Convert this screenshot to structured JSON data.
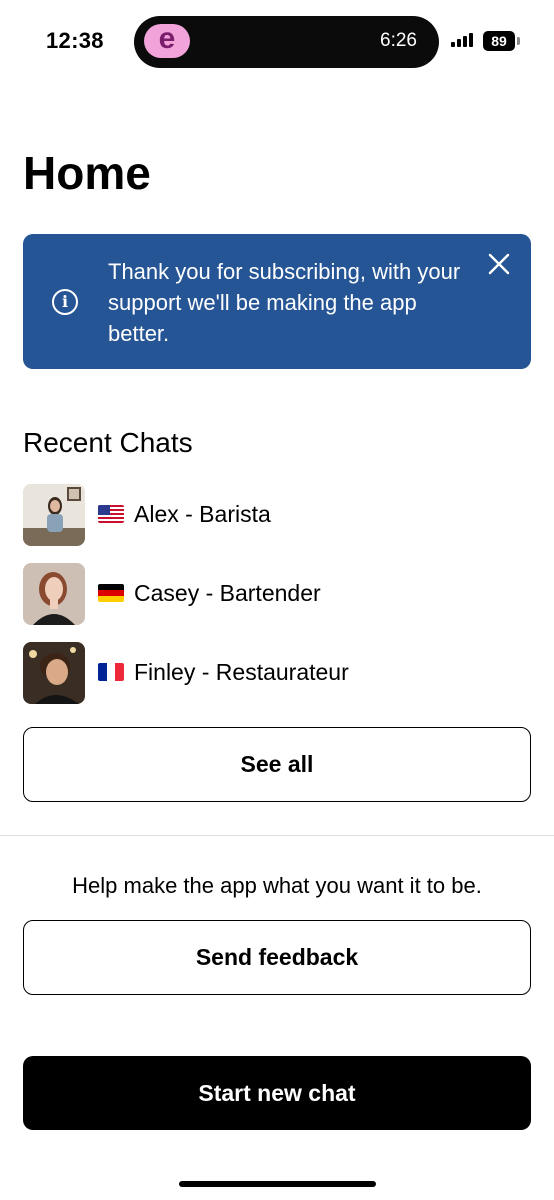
{
  "status_bar": {
    "time": "12:38",
    "live_activity_app_letter": "e",
    "live_activity_timer": "6:26",
    "battery": "89"
  },
  "page": {
    "title": "Home"
  },
  "banner": {
    "message": "Thank you for subscribing, with your support we'll be making the app better.",
    "icon": "info-icon",
    "close_icon": "close-icon",
    "background_color": "#255595"
  },
  "recent_chats": {
    "title": "Recent Chats",
    "items": [
      {
        "name": "Alex - Barista",
        "flag": "us-flag-icon"
      },
      {
        "name": "Casey - Bartender",
        "flag": "de-flag-icon"
      },
      {
        "name": "Finley - Restaurateur",
        "flag": "fr-flag-icon"
      }
    ],
    "see_all_label": "See all"
  },
  "feedback": {
    "prompt": "Help make the app what you want it to be.",
    "button_label": "Send feedback"
  },
  "primary_action": {
    "label": "Start new chat"
  }
}
